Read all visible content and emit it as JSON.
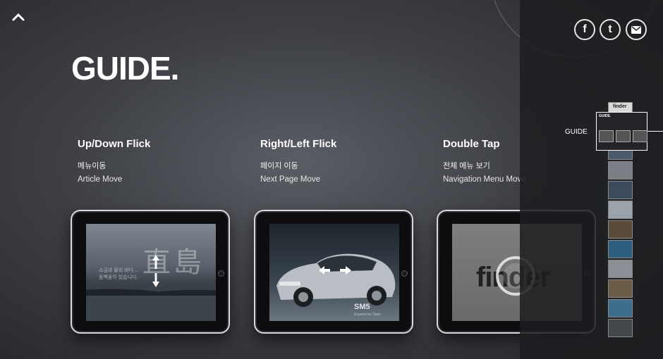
{
  "page": {
    "title": "GUIDE."
  },
  "guides": [
    {
      "heading": "Up/Down Flick",
      "korean": "메뉴이동",
      "english": "Article Move"
    },
    {
      "heading": "Right/Left Flick",
      "korean": "페이지 이동",
      "english": "Next Page Move"
    },
    {
      "heading": "Double Tap",
      "korean": "전체 메뉴 보기",
      "english": "Navigation Menu Move"
    }
  ],
  "screens": {
    "s1_kanji": "直島",
    "s1_text": "소금과 물의 바다… 동백꽃이 있습니다.",
    "s2_model": "SM5",
    "s2_sub": "Experience Start",
    "s3_brand": "finder"
  },
  "sidebar": {
    "active_label": "GUIDE",
    "active_mini_title": "GUIDE.",
    "top_thumb_text": "finder",
    "thumb_colors": [
      "#6f8a9a",
      "#4a5a6a",
      "#7a7f86",
      "#3a4b5c",
      "#9aa3aa",
      "#5c4a3a",
      "#2f5f7f",
      "#8a8f95",
      "#6b5c48",
      "#3d6f8d",
      "#44484c"
    ]
  },
  "social": {
    "facebook": "f",
    "twitter": "t",
    "mail": "mail"
  },
  "icons": {
    "up": "chevron-up-icon"
  }
}
